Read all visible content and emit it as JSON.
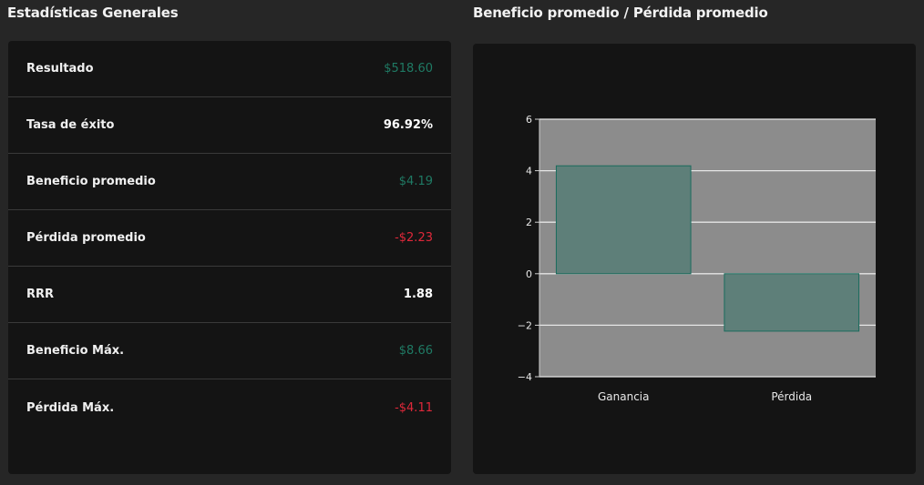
{
  "left_panel": {
    "title": "Estadísticas Generales",
    "rows": [
      {
        "label": "Resultado",
        "value": "$518.60",
        "tone": "green"
      },
      {
        "label": "Tasa de éxito",
        "value": "96.92%",
        "tone": "white"
      },
      {
        "label": "Beneficio promedio",
        "value": "$4.19",
        "tone": "green"
      },
      {
        "label": "Pérdida promedio",
        "value": "-$2.23",
        "tone": "red"
      },
      {
        "label": "RRR",
        "value": "1.88",
        "tone": "white"
      },
      {
        "label": "Beneficio Máx.",
        "value": "$8.66",
        "tone": "green"
      },
      {
        "label": "Pérdida Máx.",
        "value": "-$4.11",
        "tone": "red"
      }
    ]
  },
  "right_panel": {
    "title": "Beneficio promedio / Pérdida promedio"
  },
  "colors": {
    "green": "#1f7a64",
    "red": "#e0283a",
    "bar_fill": "#5e7f79",
    "bar_stroke": "#1a6b5c",
    "plot_bg": "#8c8c8c"
  },
  "chart_data": {
    "type": "bar",
    "categories": [
      "Ganancia",
      "Pérdida"
    ],
    "values": [
      4.19,
      -2.23
    ],
    "ylim": [
      -4,
      6
    ],
    "yticks": [
      "6",
      "4",
      "2",
      "0",
      "−2",
      "−4"
    ],
    "grid": true,
    "xlabel": "",
    "ylabel": ""
  }
}
